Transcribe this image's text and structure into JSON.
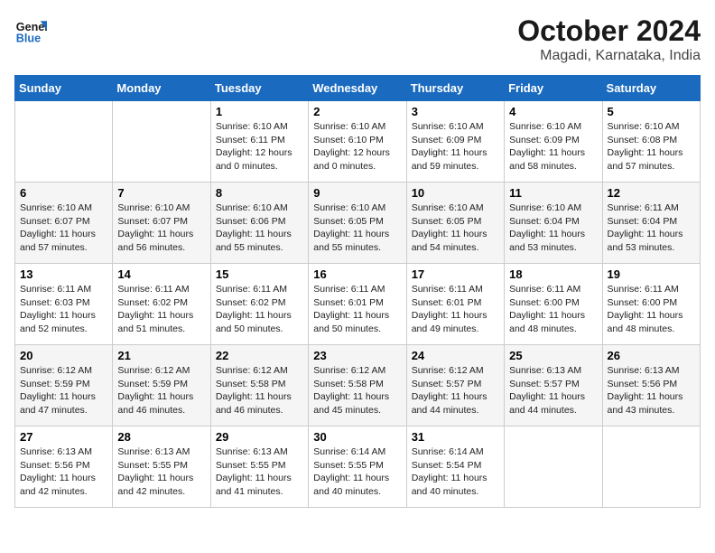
{
  "logo": {
    "general": "General",
    "blue": "Blue"
  },
  "title": "October 2024",
  "subtitle": "Magadi, Karnataka, India",
  "days_of_week": [
    "Sunday",
    "Monday",
    "Tuesday",
    "Wednesday",
    "Thursday",
    "Friday",
    "Saturday"
  ],
  "weeks": [
    [
      {
        "day": "",
        "info": ""
      },
      {
        "day": "",
        "info": ""
      },
      {
        "day": "1",
        "sunrise": "6:10 AM",
        "sunset": "6:11 PM",
        "daylight": "12 hours and 0 minutes."
      },
      {
        "day": "2",
        "sunrise": "6:10 AM",
        "sunset": "6:10 PM",
        "daylight": "12 hours and 0 minutes."
      },
      {
        "day": "3",
        "sunrise": "6:10 AM",
        "sunset": "6:09 PM",
        "daylight": "11 hours and 59 minutes."
      },
      {
        "day": "4",
        "sunrise": "6:10 AM",
        "sunset": "6:09 PM",
        "daylight": "11 hours and 58 minutes."
      },
      {
        "day": "5",
        "sunrise": "6:10 AM",
        "sunset": "6:08 PM",
        "daylight": "11 hours and 57 minutes."
      }
    ],
    [
      {
        "day": "6",
        "sunrise": "6:10 AM",
        "sunset": "6:07 PM",
        "daylight": "11 hours and 57 minutes."
      },
      {
        "day": "7",
        "sunrise": "6:10 AM",
        "sunset": "6:07 PM",
        "daylight": "11 hours and 56 minutes."
      },
      {
        "day": "8",
        "sunrise": "6:10 AM",
        "sunset": "6:06 PM",
        "daylight": "11 hours and 55 minutes."
      },
      {
        "day": "9",
        "sunrise": "6:10 AM",
        "sunset": "6:05 PM",
        "daylight": "11 hours and 55 minutes."
      },
      {
        "day": "10",
        "sunrise": "6:10 AM",
        "sunset": "6:05 PM",
        "daylight": "11 hours and 54 minutes."
      },
      {
        "day": "11",
        "sunrise": "6:10 AM",
        "sunset": "6:04 PM",
        "daylight": "11 hours and 53 minutes."
      },
      {
        "day": "12",
        "sunrise": "6:11 AM",
        "sunset": "6:04 PM",
        "daylight": "11 hours and 53 minutes."
      }
    ],
    [
      {
        "day": "13",
        "sunrise": "6:11 AM",
        "sunset": "6:03 PM",
        "daylight": "11 hours and 52 minutes."
      },
      {
        "day": "14",
        "sunrise": "6:11 AM",
        "sunset": "6:02 PM",
        "daylight": "11 hours and 51 minutes."
      },
      {
        "day": "15",
        "sunrise": "6:11 AM",
        "sunset": "6:02 PM",
        "daylight": "11 hours and 50 minutes."
      },
      {
        "day": "16",
        "sunrise": "6:11 AM",
        "sunset": "6:01 PM",
        "daylight": "11 hours and 50 minutes."
      },
      {
        "day": "17",
        "sunrise": "6:11 AM",
        "sunset": "6:01 PM",
        "daylight": "11 hours and 49 minutes."
      },
      {
        "day": "18",
        "sunrise": "6:11 AM",
        "sunset": "6:00 PM",
        "daylight": "11 hours and 48 minutes."
      },
      {
        "day": "19",
        "sunrise": "6:11 AM",
        "sunset": "6:00 PM",
        "daylight": "11 hours and 48 minutes."
      }
    ],
    [
      {
        "day": "20",
        "sunrise": "6:12 AM",
        "sunset": "5:59 PM",
        "daylight": "11 hours and 47 minutes."
      },
      {
        "day": "21",
        "sunrise": "6:12 AM",
        "sunset": "5:59 PM",
        "daylight": "11 hours and 46 minutes."
      },
      {
        "day": "22",
        "sunrise": "6:12 AM",
        "sunset": "5:58 PM",
        "daylight": "11 hours and 46 minutes."
      },
      {
        "day": "23",
        "sunrise": "6:12 AM",
        "sunset": "5:58 PM",
        "daylight": "11 hours and 45 minutes."
      },
      {
        "day": "24",
        "sunrise": "6:12 AM",
        "sunset": "5:57 PM",
        "daylight": "11 hours and 44 minutes."
      },
      {
        "day": "25",
        "sunrise": "6:13 AM",
        "sunset": "5:57 PM",
        "daylight": "11 hours and 44 minutes."
      },
      {
        "day": "26",
        "sunrise": "6:13 AM",
        "sunset": "5:56 PM",
        "daylight": "11 hours and 43 minutes."
      }
    ],
    [
      {
        "day": "27",
        "sunrise": "6:13 AM",
        "sunset": "5:56 PM",
        "daylight": "11 hours and 42 minutes."
      },
      {
        "day": "28",
        "sunrise": "6:13 AM",
        "sunset": "5:55 PM",
        "daylight": "11 hours and 42 minutes."
      },
      {
        "day": "29",
        "sunrise": "6:13 AM",
        "sunset": "5:55 PM",
        "daylight": "11 hours and 41 minutes."
      },
      {
        "day": "30",
        "sunrise": "6:14 AM",
        "sunset": "5:55 PM",
        "daylight": "11 hours and 40 minutes."
      },
      {
        "day": "31",
        "sunrise": "6:14 AM",
        "sunset": "5:54 PM",
        "daylight": "11 hours and 40 minutes."
      },
      {
        "day": "",
        "info": ""
      },
      {
        "day": "",
        "info": ""
      }
    ]
  ],
  "labels": {
    "sunrise": "Sunrise:",
    "sunset": "Sunset:",
    "daylight": "Daylight:"
  },
  "colors": {
    "header_bg": "#1a6abf",
    "header_text": "#ffffff"
  }
}
